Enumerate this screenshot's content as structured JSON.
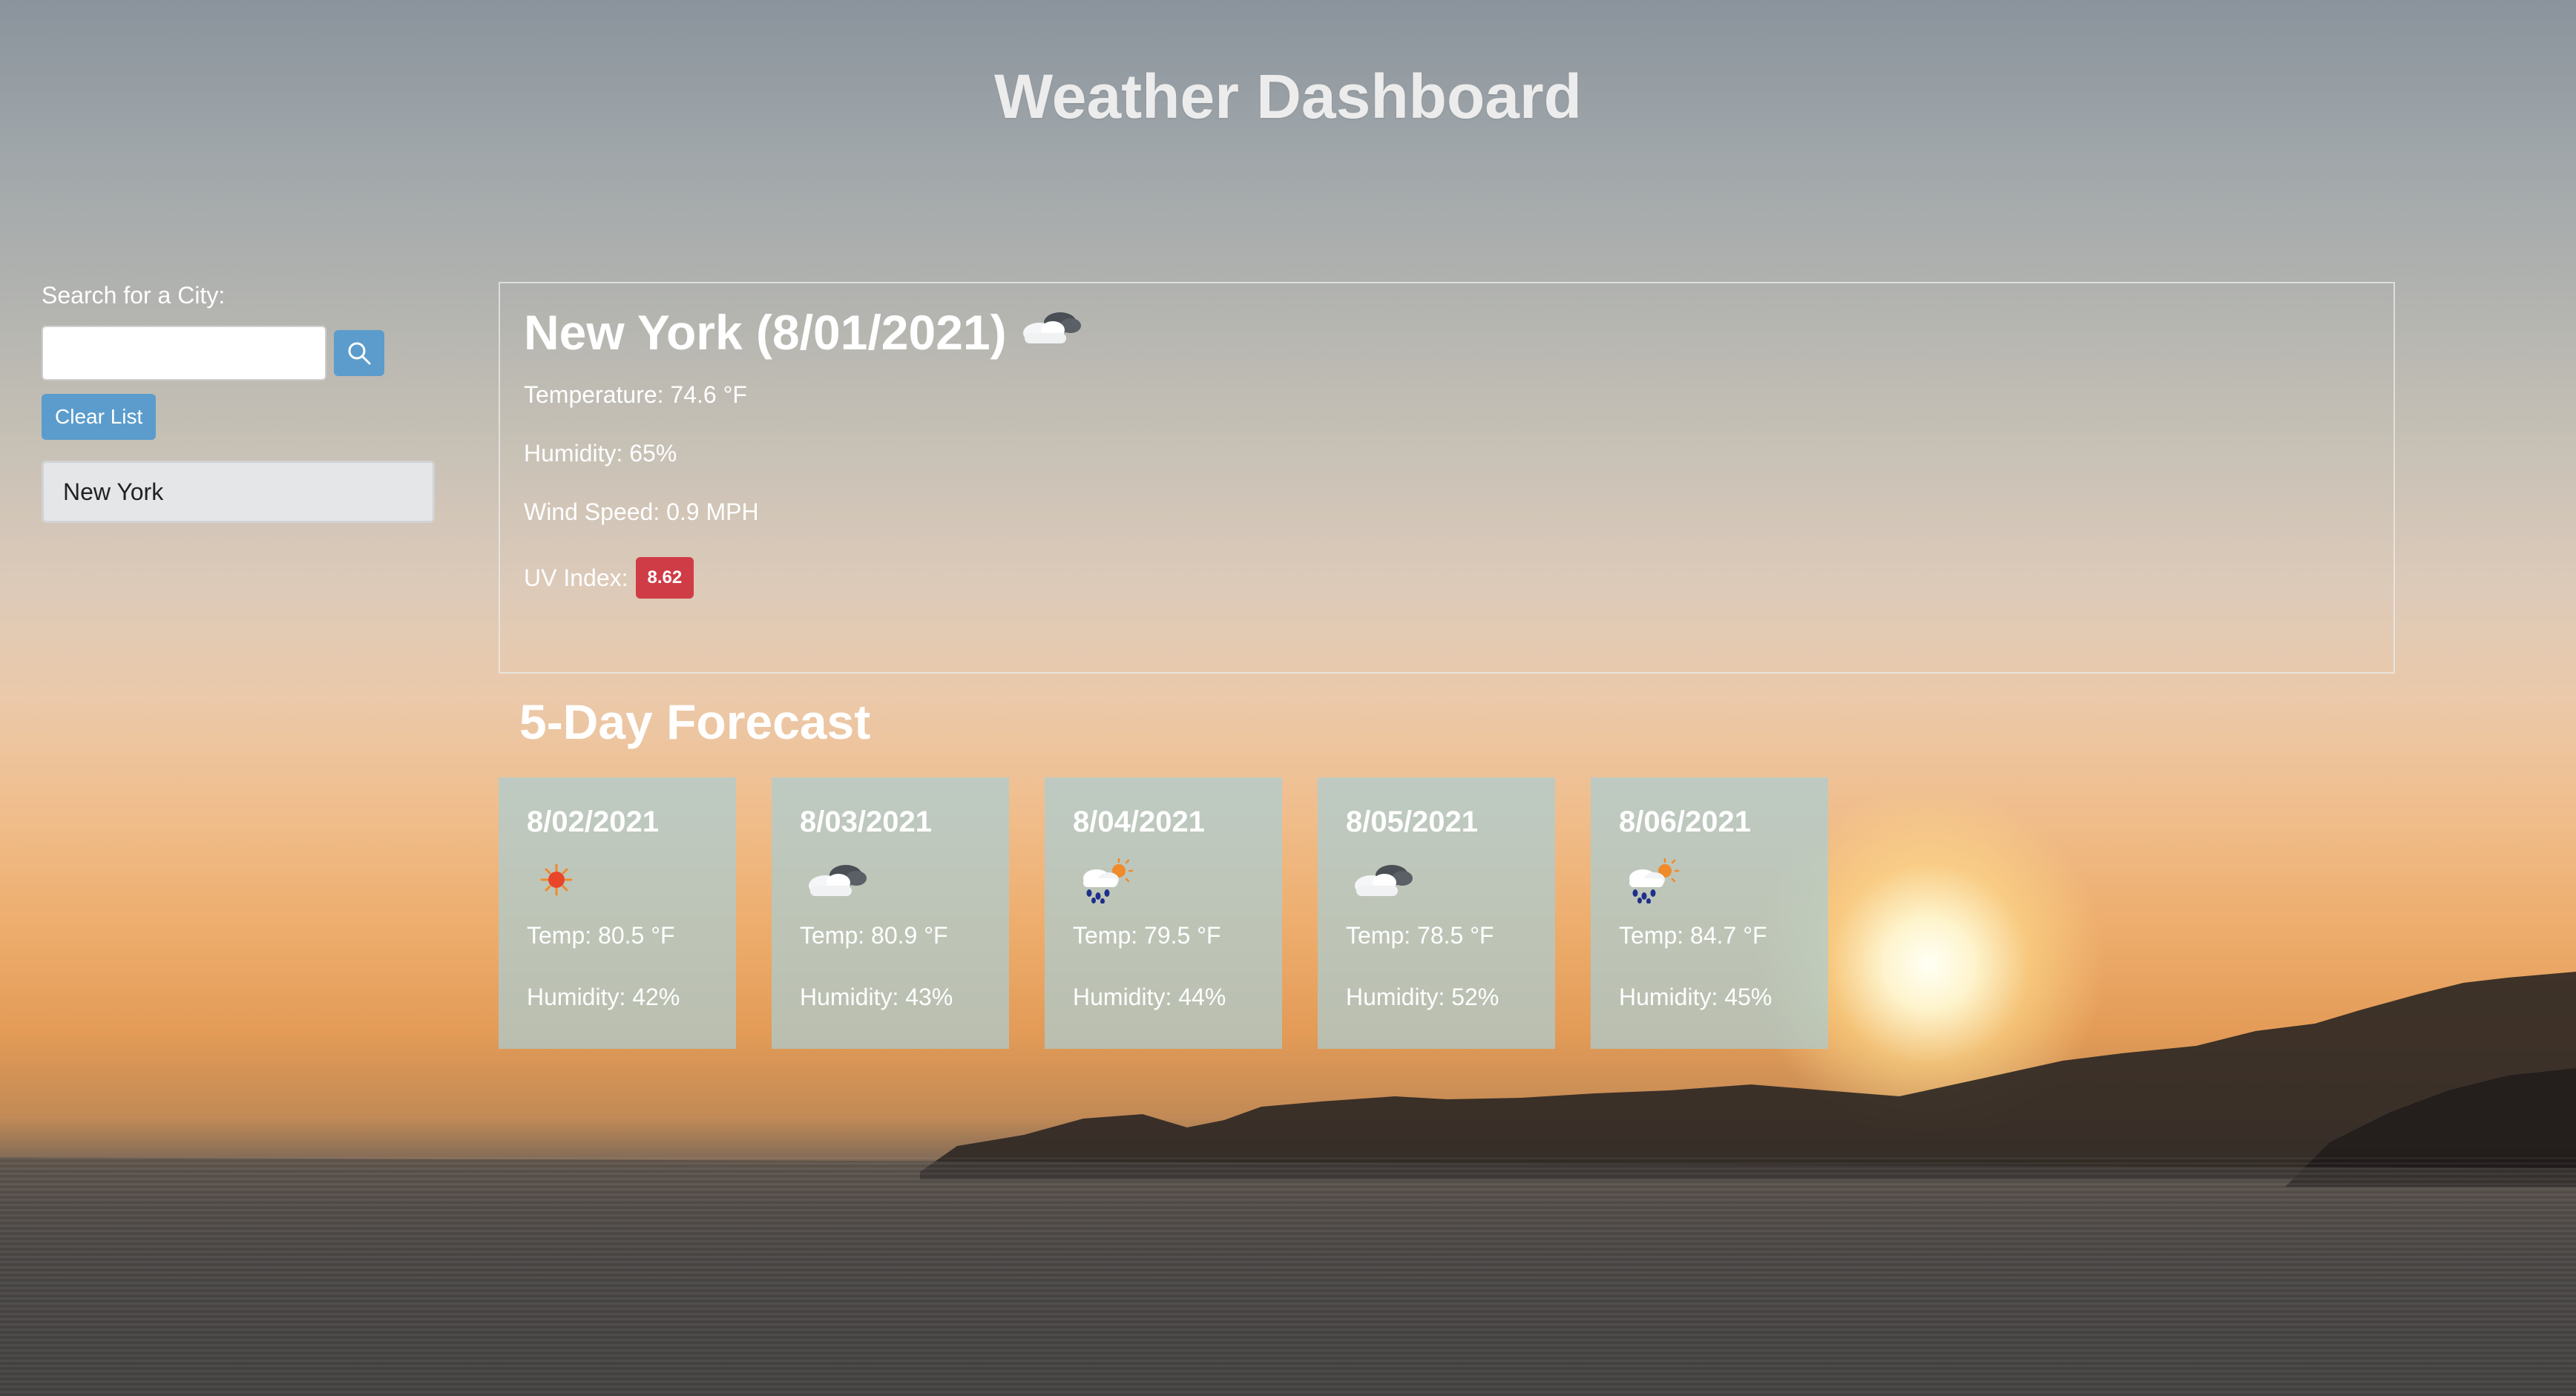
{
  "header": {
    "title": "Weather Dashboard"
  },
  "sidebar": {
    "search_label": "Search for a City:",
    "search_value": "",
    "search_button_icon": "search-icon",
    "clear_label": "Clear List",
    "history": [
      "New York"
    ]
  },
  "current": {
    "title": "New York (8/01/2021)",
    "icon": "cloud-icon",
    "temperature": "Temperature: 74.6 °F",
    "humidity": "Humidity: 65%",
    "wind": "Wind Speed: 0.9 MPH",
    "uv_label": "UV Index:",
    "uv_value": "8.62",
    "uv_color": "#cf3c46"
  },
  "forecast": {
    "title": "5-Day Forecast",
    "days": [
      {
        "date": "8/02/2021",
        "icon": "sun-icon",
        "temp": "Temp: 80.5 °F",
        "humidity": "Humidity: 42%"
      },
      {
        "date": "8/03/2021",
        "icon": "cloud-icon",
        "temp": "Temp: 80.9 °F",
        "humidity": "Humidity: 43%"
      },
      {
        "date": "8/04/2021",
        "icon": "rain-sun-icon",
        "temp": "Temp: 79.5 °F",
        "humidity": "Humidity: 44%"
      },
      {
        "date": "8/05/2021",
        "icon": "cloud-icon",
        "temp": "Temp: 78.5 °F",
        "humidity": "Humidity: 52%"
      },
      {
        "date": "8/06/2021",
        "icon": "rain-sun-icon",
        "temp": "Temp: 84.7 °F",
        "humidity": "Humidity: 45%"
      }
    ]
  },
  "colors": {
    "button": "#5b9ccc",
    "uv_high": "#cf3c46",
    "card_bg": "#aacdd2"
  }
}
